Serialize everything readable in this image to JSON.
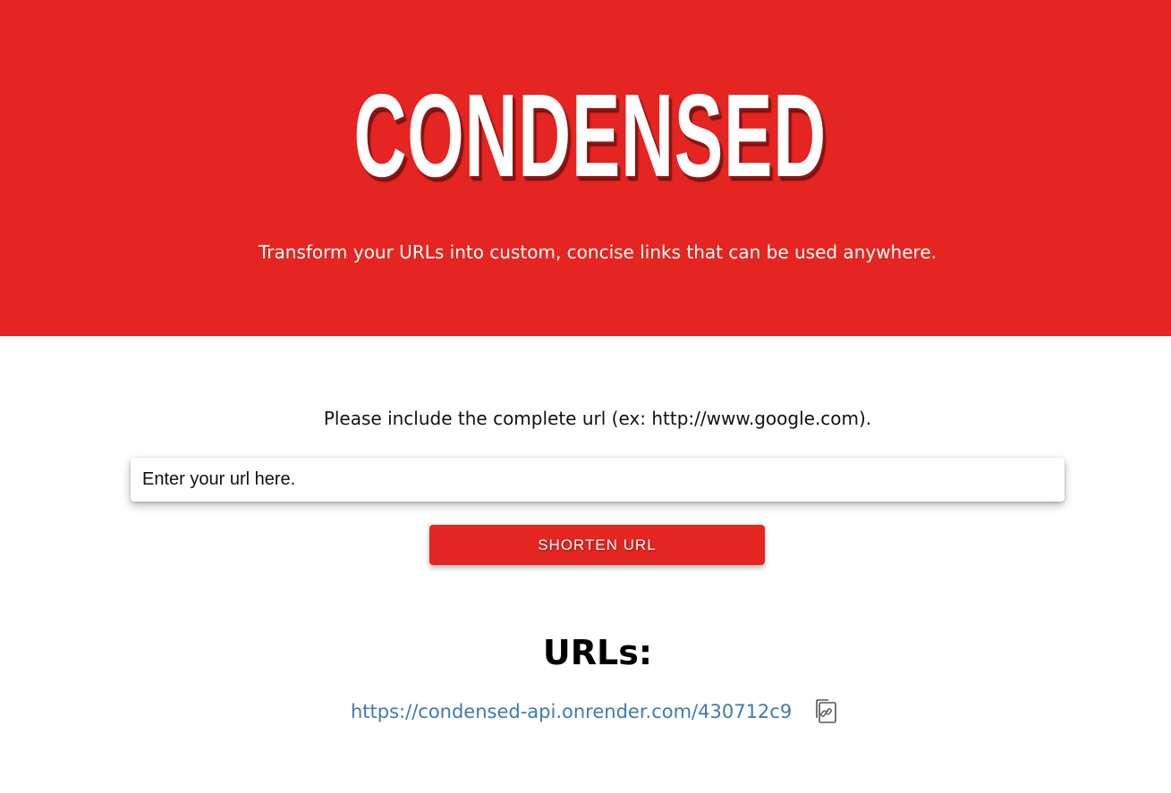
{
  "header": {
    "logo_text": "CONDENSED",
    "tagline": "Transform your URLs into custom, concise links that can be used anywhere."
  },
  "form": {
    "instructions": "Please include the complete url (ex: http://www.google.com).",
    "url_input_placeholder": "Enter your url here.",
    "url_input_value": "",
    "submit_label": "SHORTEN URL"
  },
  "urls": {
    "heading": "URLs:",
    "items": [
      {
        "short_url": "https://condensed-api.onrender.com/430712c9",
        "copy_icon": "copy-link-icon"
      }
    ]
  },
  "colors": {
    "brand_red": "#e42521",
    "link_blue": "#3d7ab5",
    "white": "#ffffff"
  }
}
